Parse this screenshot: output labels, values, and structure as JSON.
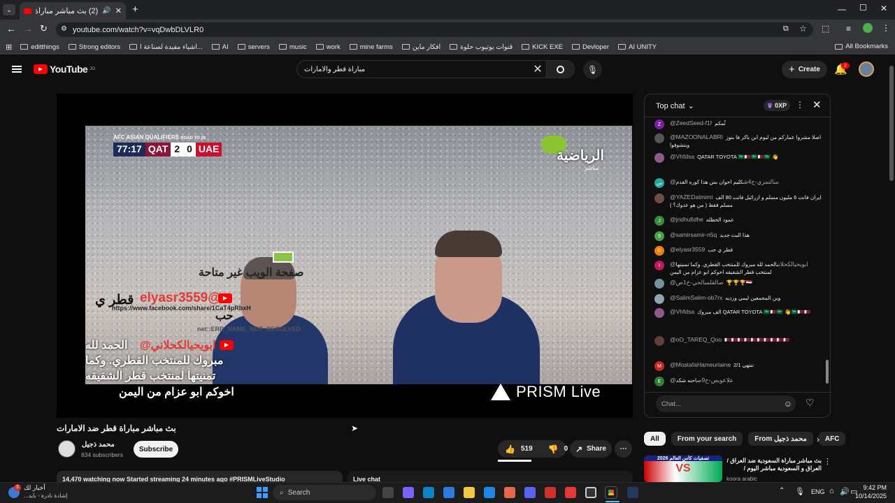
{
  "browser": {
    "tab_title": "(2) بث مباشر مباراة قطر ضد",
    "url": "youtube.com/watch?v=vqDwbDLVLR0",
    "bookmarks": [
      "editthings",
      "Strong editors",
      "اشياء مفيدة لصناعة ا...",
      "AI",
      "servers",
      "music",
      "work",
      "mine farms",
      "افكار ماين",
      "قنوات يوتيوب حلوة",
      "KICK EXE",
      "Devloper",
      "AI UNITY"
    ],
    "all_bookmarks": "All Bookmarks"
  },
  "youtube": {
    "logo": "YouTube",
    "logo_sup": "JO",
    "search_value": "مباراة قطر والامارات",
    "create_label": "Create",
    "notif_count": "2"
  },
  "video": {
    "scoreboard_title": "AFC ASIAN QUALIFIERS",
    "scoreboard_sub": "ROAD TO 26",
    "time": "77:17",
    "team1": "QAT",
    "score1": "2",
    "score2": "0",
    "team2": "UAE",
    "channel_logo_text": "الرياضية",
    "channel_logo_sub": "مباشر",
    "overlay_1": "صفحة الويب غير متاحة",
    "overlay_2": "elyasr3559@",
    "overlay_2b": "قطر ي",
    "overlay_3": "https://www.facebook.com/share/1CaT4pRbxH",
    "overlay_4": "حب",
    "overlay_5": "net::ERR_NAME_NOT_RESOLVED",
    "overlay_6": "ابويحيالكحلاني@",
    "overlay_6b": "الحمد لله",
    "overlay_7": "مبروك للمنتخب القطري. وكما",
    "overlay_8": "تمنيتها لمنتخب قطر الشقيقه",
    "overlay_9": "اخوكم ابو عزام من اليمن",
    "prism": "PRISM Live",
    "title": "بث مباشر مباراة قطر ضد الامارات",
    "channel_name": "محمد ذجيل",
    "subscribers": "834 subscribers",
    "subscribe_label": "Subscribe",
    "likes": "519",
    "dislikes": "0",
    "share_label": "Share",
    "stats": "14,470 watching now  Started streaming 24 minutes ago  #PRISMLiveStudio",
    "live_chat_label": "Live chat"
  },
  "chat": {
    "header": "Top chat",
    "xp": "0XP",
    "placeholder": "Chat...",
    "messages": [
      {
        "name": "@ZeedSeed-f1f",
        "text": "ثُمكم",
        "color": "#7b1fa2",
        "initial": "Z"
      },
      {
        "name": "@MAZOONALABRI",
        "text": "اصلا مشروا عماركم من ليوم ابن باكر فا بنوز وبتشوفوا",
        "color": "#555",
        "initial": ""
      },
      {
        "name": "@Vhfdsa",
        "text": "QATAR TOYOTA 🇸🇦🇶🇦🇸🇦🇶🇦🇸🇦 👋",
        "color": "#8e5a8a",
        "initial": ""
      },
      {
        "name": "@سالتمري-ج4ش",
        "text": "كليم اخوان بس هذا كوره القدم",
        "color": "#26a69a",
        "initial": "س"
      },
      {
        "name": "@YAZEDatmimi",
        "text": "ايران فاتت 6 مليون مسلم و ازرائيل فاتت 80 الف مسلم فقط ( من هو عدوك؟ )",
        "color": "#6d4c41",
        "initial": ""
      },
      {
        "name": "@jridhufidhe",
        "text": "عمود الحظله",
        "color": "#388e3c",
        "initial": "J"
      },
      {
        "name": "@samirsamir-n5q",
        "text": "هذا البث جديد",
        "color": "#43a047",
        "initial": "S"
      },
      {
        "name": "@elyasr3559",
        "text": "قطر ي حب",
        "color": "#f57c00",
        "initial": "G"
      },
      {
        "name": "@ابويحيالكحلاني",
        "text": "الحمد لله مبروك للمنتخب القطري. وكما تمنيتها لمنتخب قطر الشقيقه اخوكم ابو عزام من اليمن",
        "color": "#c2185b",
        "initial": "I"
      },
      {
        "name": "@صالقلسالحي-خ1ص",
        "text": "🏆🏆🏆🇾🇪",
        "color": "#78909c",
        "initial": ""
      },
      {
        "name": "@SalimSalim-ob7rx",
        "text": "وين المجمعين ليمي ورديه",
        "color": "#90a4ae",
        "initial": ""
      },
      {
        "name": "@Vhfdsa",
        "text": "الف مبروك QATAR TOYOTA 🇸🇦🇶🇦🇸🇦 👋🇸🇦🇶🇦🇶🇦",
        "color": "#8e5a8a",
        "initial": ""
      },
      {
        "name": "@oO_TAREQ_Qoo",
        "text": "🇶🇦🇶🇦🇶🇦🇶🇦🇶🇦🇶🇦🇶🇦🇶🇦🇶🇦🇶🇦",
        "color": "#5d4037",
        "initial": ""
      },
      {
        "name": "@MostafaHameurlaine",
        "text": "2/1 تنتهي",
        "color": "#c62828",
        "initial": "M"
      },
      {
        "name": "@علاعوبص-ح9ص",
        "text": "احنه شكد",
        "color": "#2e7d32",
        "initial": "E"
      }
    ]
  },
  "chips": [
    "All",
    "From your search",
    "From محمد ذجيل",
    "AFC"
  ],
  "rec": {
    "thumb_text": "تصفيات كأس العالم 2026",
    "title": "بث مباشر مباراة السعودية ضد العراق / العراق و السعودية مباشر اليوم / تصفيات",
    "channel": "koora arabic"
  },
  "taskbar": {
    "weather_title": "أخبار لك",
    "weather_sub": "إشادة نادرة - بايد...",
    "search_label": "Search",
    "lang": "ENG",
    "time": "9:42 PM",
    "date": "10/14/2025",
    "badge": "3"
  }
}
